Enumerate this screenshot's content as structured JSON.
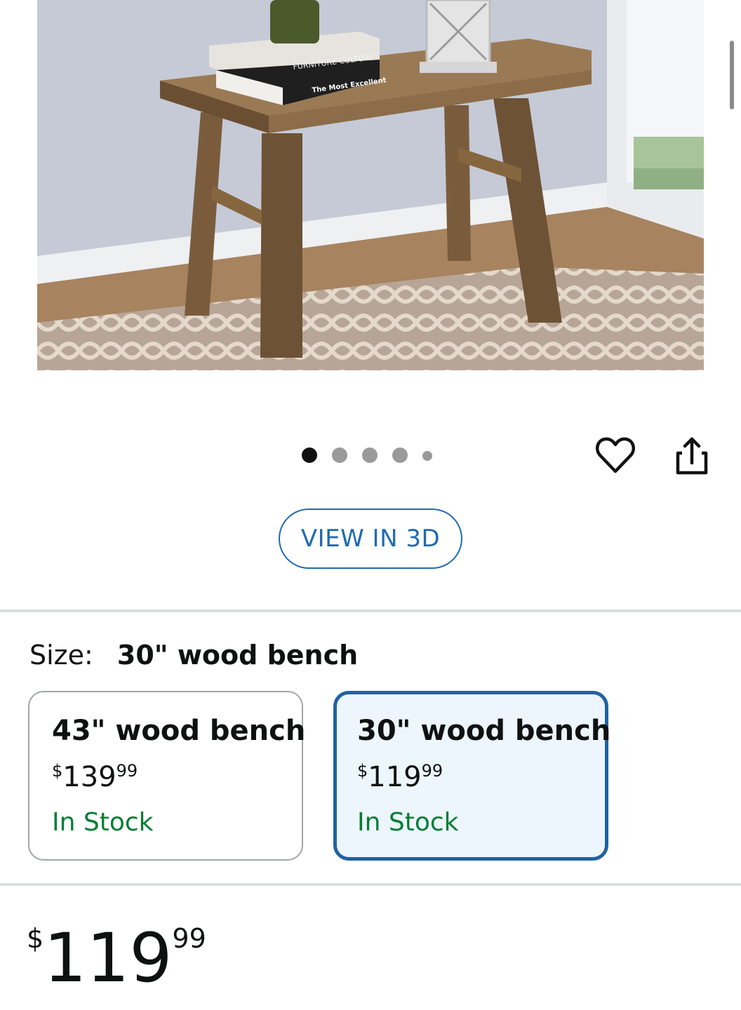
{
  "product_image": {
    "book_top_title": "FURNITURE CULTURE",
    "book_bottom_title": "The Most Excellent"
  },
  "carousel": {
    "count": 5,
    "active_index": 0
  },
  "view_3d": {
    "label": "VIEW IN 3D"
  },
  "size_selector": {
    "label": "Size:",
    "selected_value": "30\" wood bench",
    "options": [
      {
        "name": "43\" wood bench",
        "price_symbol": "$",
        "price_whole": "139",
        "price_fraction": "99",
        "stock": "In Stock",
        "selected": false
      },
      {
        "name": "30\" wood bench",
        "price_symbol": "$",
        "price_whole": "119",
        "price_fraction": "99",
        "stock": "In Stock",
        "selected": true
      }
    ]
  },
  "price": {
    "symbol": "$",
    "whole": "119",
    "fraction": "99"
  },
  "colors": {
    "accent": "#2162a1",
    "in_stock": "#067d35",
    "selected_bg": "#edf6fd"
  }
}
